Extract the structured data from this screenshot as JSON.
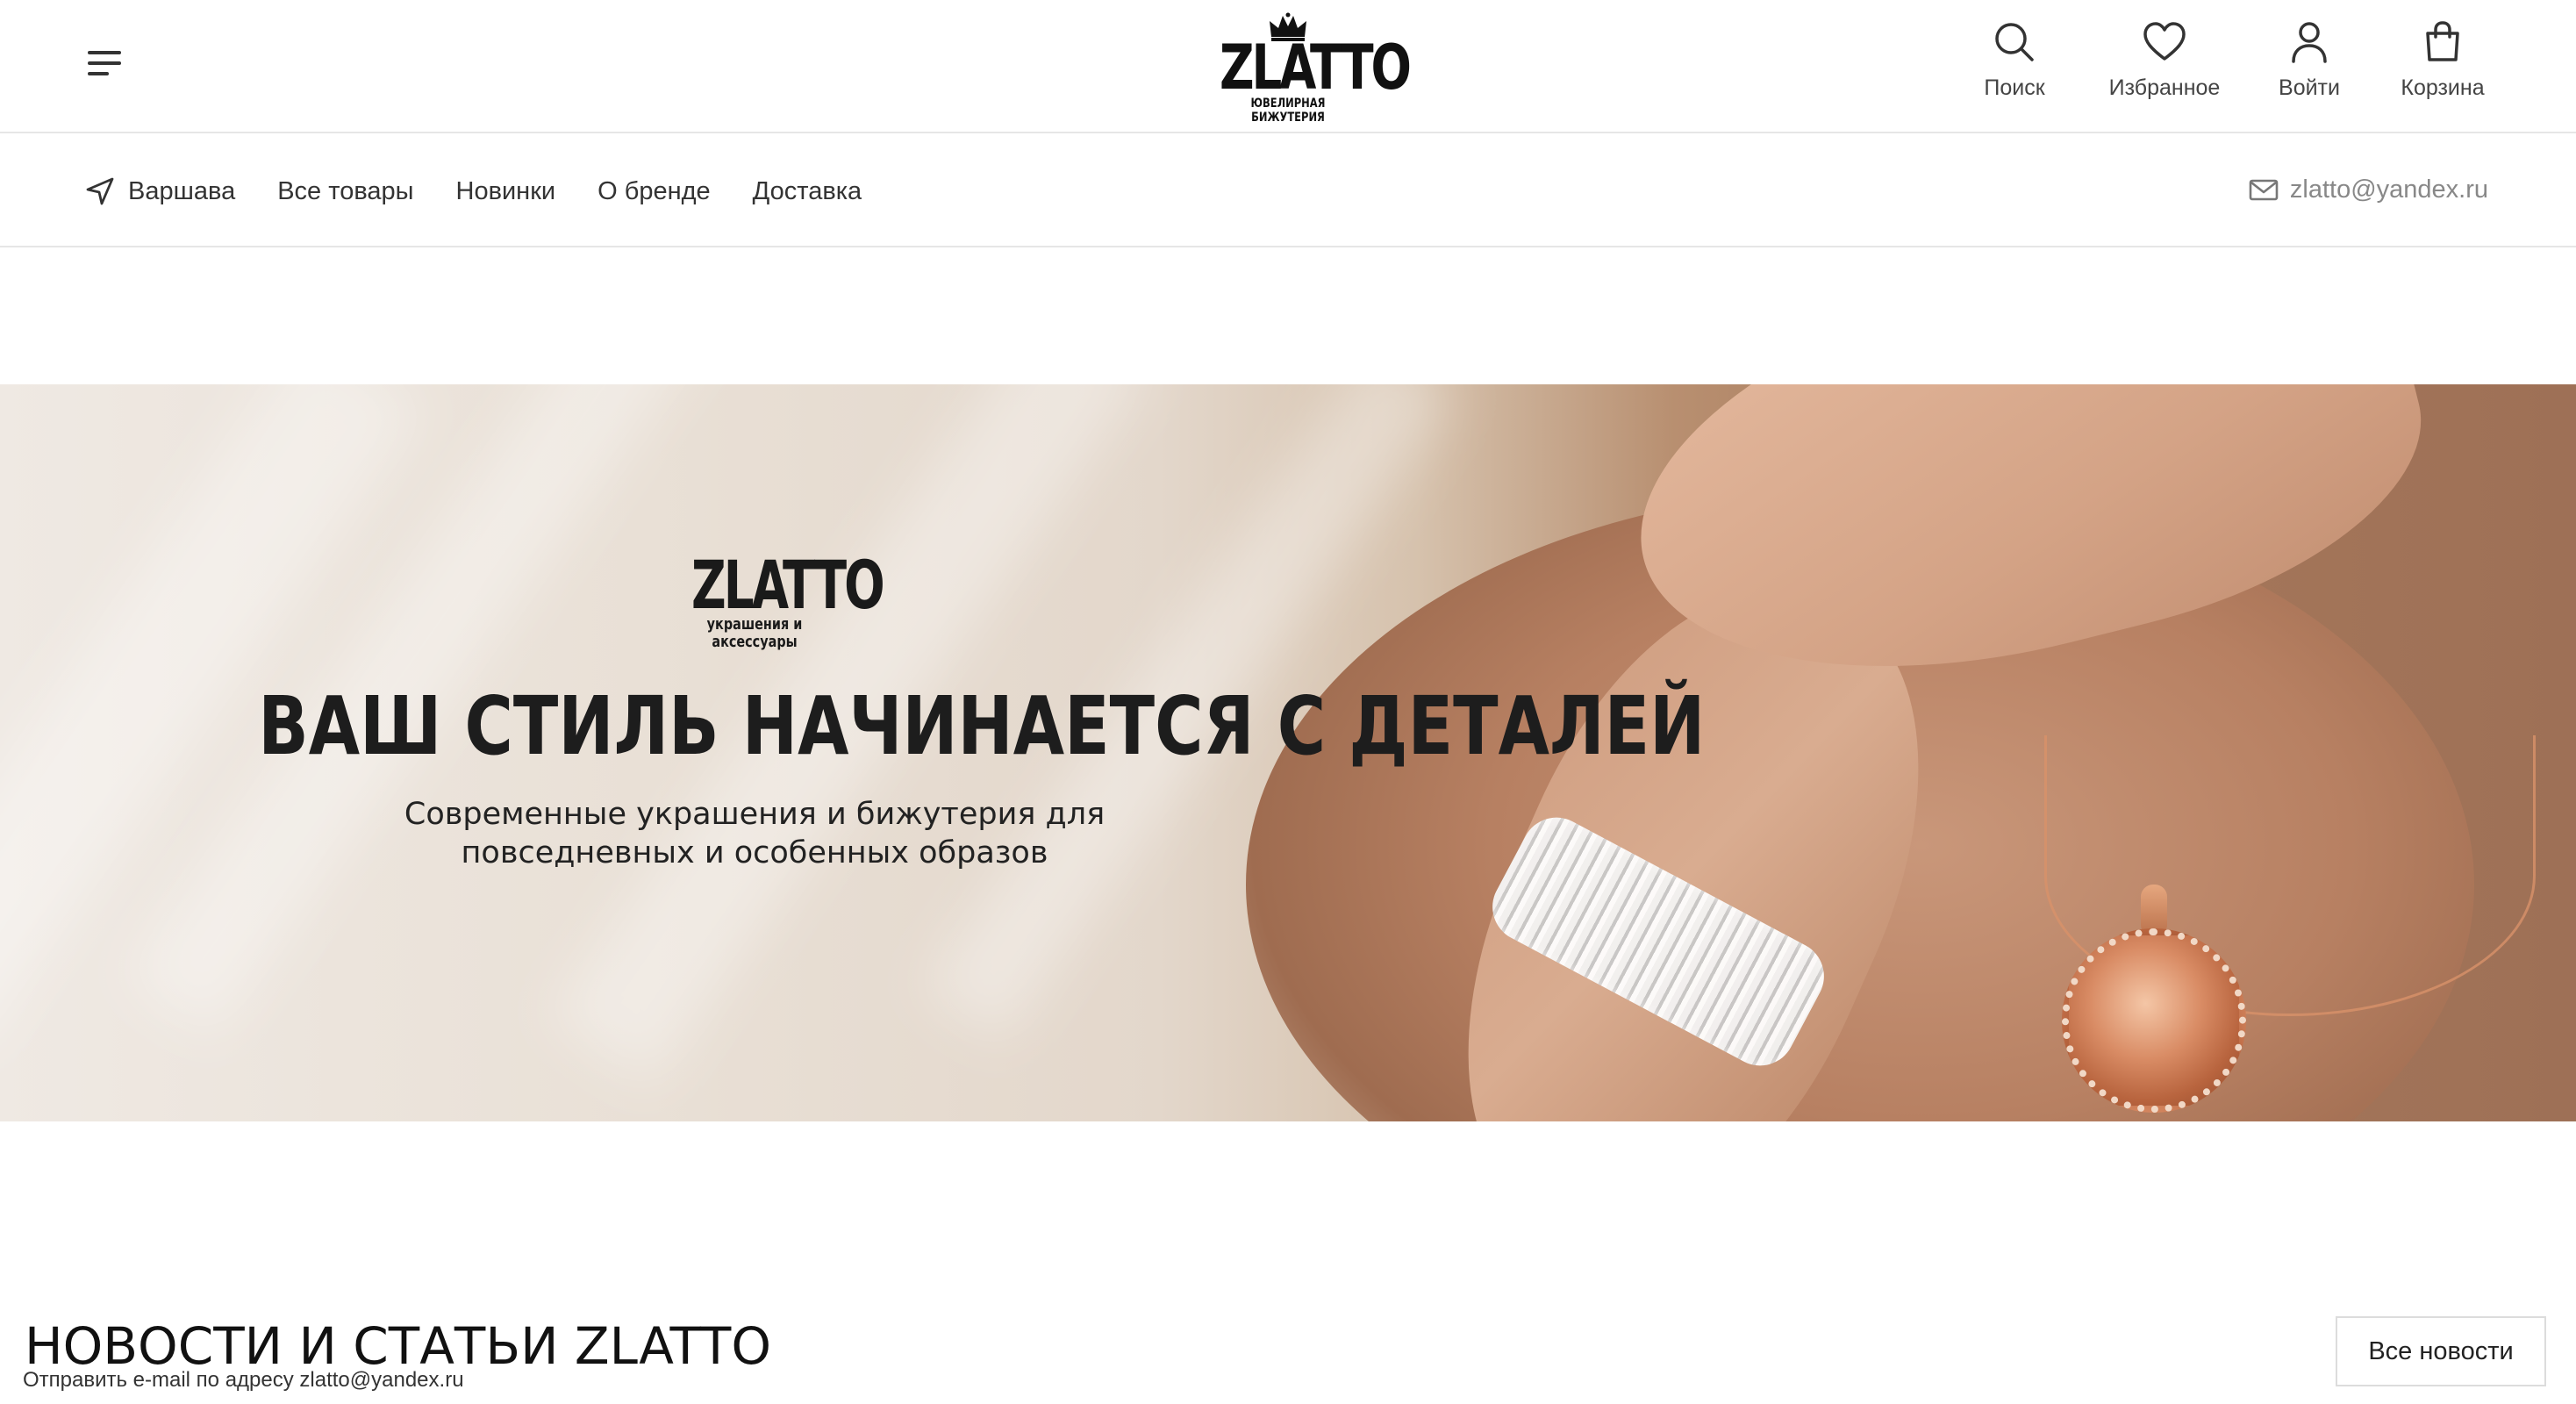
{
  "header": {
    "logo_text": "ZLATTO",
    "logo_subtitle": "ЮВЕЛИРНАЯ БИЖУТЕРИЯ",
    "actions": {
      "search": "Поиск",
      "favorites": "Избранное",
      "login": "Войти",
      "cart": "Корзина"
    }
  },
  "nav": {
    "city": "Варшава",
    "links": [
      "Все товары",
      "Новинки",
      "О бренде",
      "Доставка"
    ],
    "email": "zlatto@yandex.ru"
  },
  "hero": {
    "logo_text": "ZLATTO",
    "logo_subtitle": "украшения и аксессуары",
    "title": "ВАШ СТИЛЬ НАЧИНАЕТСЯ С ДЕТАЛЕЙ",
    "subtitle_line1": "Современные украшения и бижутерия для",
    "subtitle_line2": "повседневных и особенных образов"
  },
  "news": {
    "heading": "НОВОСТИ И СТАТЬИ ZLATTO",
    "all_button": "Все новости"
  },
  "statusbar": {
    "text": "Отправить e-mail по адресу zlatto@yandex.ru"
  }
}
